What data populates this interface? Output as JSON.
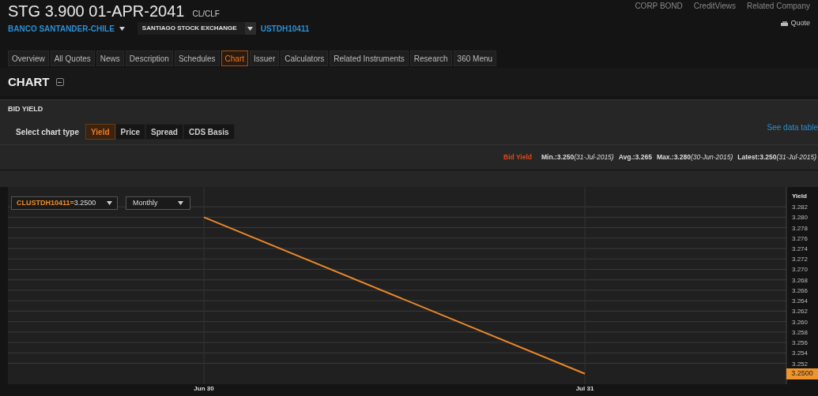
{
  "header": {
    "title": "STG 3.900 01-APR-2041",
    "currency": "CL/CLF",
    "issuer": "BANCO SANTANDER-CHILE",
    "exchange": "SANTIAGO STOCK EXCHANGE",
    "ticker": "USTDH10411",
    "top_links": [
      "CORP BOND",
      "CreditViews",
      "Related Company"
    ],
    "quote_link": "Quote"
  },
  "tabs": [
    {
      "label": "Overview",
      "selected": false
    },
    {
      "label": "All Quotes",
      "selected": false
    },
    {
      "label": "News",
      "selected": false
    },
    {
      "label": "Description",
      "selected": false
    },
    {
      "label": "Schedules",
      "selected": false
    },
    {
      "label": "Chart",
      "selected": true
    },
    {
      "label": "Issuer",
      "selected": false
    },
    {
      "label": "Calculators",
      "selected": false
    },
    {
      "label": "Related Instruments",
      "selected": false
    },
    {
      "label": "Research",
      "selected": false
    },
    {
      "label": "360 Menu",
      "selected": false
    }
  ],
  "section_title": "CHART",
  "panel_title": "BID YIELD",
  "chart_type_label": "Select chart type",
  "chart_types": [
    {
      "label": "Yield",
      "selected": true
    },
    {
      "label": "Price",
      "selected": false
    },
    {
      "label": "Spread",
      "selected": false
    },
    {
      "label": "CDS Basis",
      "selected": false
    }
  ],
  "see_data_table": "See data table",
  "stats": {
    "name": "Bid Yield",
    "items": [
      {
        "value": "Min.:3.250",
        "date": "(31-Jul-2015)"
      },
      {
        "value": "Avg.:3.265"
      },
      {
        "value": "Max.:3.280",
        "date": "(30-Jun-2015)"
      },
      {
        "value": "Latest:3.250",
        "date": "(31-Jul-2015)"
      }
    ]
  },
  "series_value": "3.2500",
  "interval_selector": "Monthly",
  "latest_marker": "3.2500",
  "chart_data": {
    "type": "line",
    "ylabel": "Yield",
    "x": [
      "Jun 30",
      "Jul 31"
    ],
    "grid": true,
    "ylim": [
      3.248,
      3.2858
    ],
    "series": [
      {
        "name": "CLUSTDH10411=",
        "color": "#e8872a",
        "values": [
          3.28,
          3.25
        ]
      }
    ],
    "yticks": [
      {
        "value": 3.252,
        "label": "3.252"
      },
      {
        "value": 3.254,
        "label": "3.254"
      },
      {
        "value": 3.256,
        "label": "3.256"
      },
      {
        "value": 3.258,
        "label": "3.258"
      },
      {
        "value": 3.26,
        "label": "3.260"
      },
      {
        "value": 3.262,
        "label": "3.262"
      },
      {
        "value": 3.264,
        "label": "3.264"
      },
      {
        "value": 3.266,
        "label": "3.266"
      },
      {
        "value": 3.268,
        "label": "3.268"
      },
      {
        "value": 3.27,
        "label": "3.270"
      },
      {
        "value": 3.272,
        "label": "3.272"
      },
      {
        "value": 3.274,
        "label": "3.274"
      },
      {
        "value": 3.276,
        "label": "3.276"
      },
      {
        "value": 3.278,
        "label": "3.278"
      },
      {
        "value": 3.28,
        "label": "3.280"
      },
      {
        "value": 3.282,
        "label": "3.282"
      }
    ]
  }
}
